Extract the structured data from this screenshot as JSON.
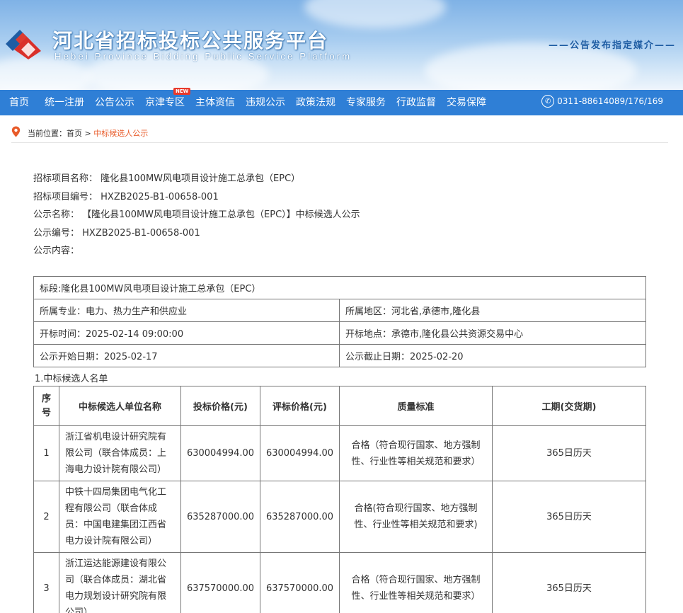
{
  "header": {
    "site_title": "河北省招标投标公共服务平台",
    "site_subtitle": "Hebei Province Bidding Public Service Platform",
    "media_tag": "——公告发布指定媒介——"
  },
  "nav": {
    "items": [
      "首页",
      "统一注册",
      "公告公示",
      "京津专区",
      "主体资信",
      "违规公示",
      "政策法规",
      "专家服务",
      "行政监督",
      "交易保障"
    ],
    "new_badge": "NEW",
    "phone": "0311-88614089/176/169"
  },
  "breadcrumb": {
    "prefix": "当前位置：",
    "home": "首页",
    "separator": " > ",
    "current": "中标候选人公示"
  },
  "info": {
    "project_name_label": "招标项目名称：",
    "project_name": "隆化县100MW风电项目设计施工总承包（EPC）",
    "project_code_label": "招标项目编号：",
    "project_code": "HXZB2025-B1-00658-001",
    "notice_name_label": "公示名称：",
    "notice_name": "【隆化县100MW风电项目设计施工总承包（EPC）】中标候选人公示",
    "notice_code_label": "公示编号：",
    "notice_code": "HXZB2025-B1-00658-001",
    "content_label": "公示内容："
  },
  "section": {
    "lot": "标段:隆化县100MW风电项目设计施工总承包（EPC）",
    "industry_label": "所属专业：",
    "industry": "电力、热力生产和供应业",
    "region_label": "所属地区：",
    "region": "河北省,承德市,隆化县",
    "open_time_label": "开标时间：",
    "open_time": "2025-02-14 09:00:00",
    "open_place_label": "开标地点：",
    "open_place": "承德市,隆化县公共资源交易中心",
    "start_date_label": "公示开始日期：",
    "start_date": "2025-02-17",
    "end_date_label": "公示截止日期：",
    "end_date": "2025-02-20"
  },
  "candidates": {
    "title": "1.中标候选人名单",
    "headers": [
      "序号",
      "中标候选人单位名称",
      "投标价格(元)",
      "评标价格(元)",
      "质量标准",
      "工期(交货期)"
    ],
    "rows": [
      {
        "no": "1",
        "name": "浙江省机电设计研究院有限公司（联合体成员：上海电力设计院有限公司）",
        "bid_price": "630004994.00",
        "eval_price": "630004994.00",
        "quality": "合格（符合现行国家、地方强制性、行业性等相关规范和要求）",
        "duration": "365日历天"
      },
      {
        "no": "2",
        "name": "中铁十四局集团电气化工程有限公司（联合体成员：中国电建集团江西省电力设计院有限公司）",
        "bid_price": "635287000.00",
        "eval_price": "635287000.00",
        "quality": "合格(符合现行国家、地方强制性、行业性等相关规范和要求)",
        "duration": "365日历天"
      },
      {
        "no": "3",
        "name": "浙江运达能源建设有限公司（联合体成员：湖北省电力规划设计研究院有限公司）",
        "bid_price": "637570000.00",
        "eval_price": "637570000.00",
        "quality": "合格（符合现行国家、地方强制性、行业性等相关规范和要求）",
        "duration": "365日历天"
      }
    ]
  },
  "colors": {
    "nav_bg": "#2f7fd6",
    "accent_orange": "#e85b2a",
    "title_blue": "#1f5da3"
  }
}
